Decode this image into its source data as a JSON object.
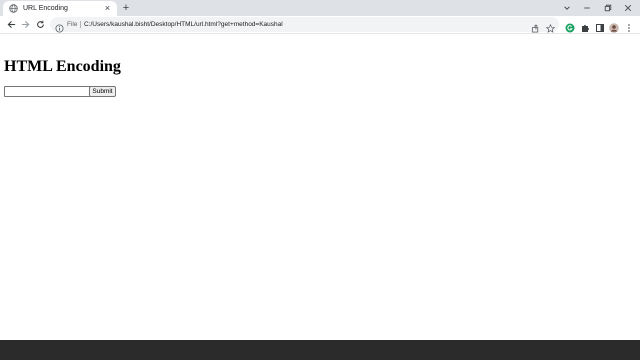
{
  "browser": {
    "tab": {
      "title": "URL Encoding",
      "close_glyph": "×"
    },
    "new_tab_glyph": "+",
    "address_bar": {
      "scheme_label": "File",
      "url": "C:/Users/kaushal.bisht/Desktop/HTML/url.html?get+method=Kaushal"
    }
  },
  "page": {
    "heading": "HTML Encoding",
    "input": {
      "value": "",
      "placeholder": ""
    },
    "submit_label": "Submit"
  },
  "colors": {
    "tab_strip": "#dee1e6",
    "omnibox": "#f1f3f4",
    "taskbar": "#2b2b2b",
    "extension_accent": "#1aa260"
  }
}
